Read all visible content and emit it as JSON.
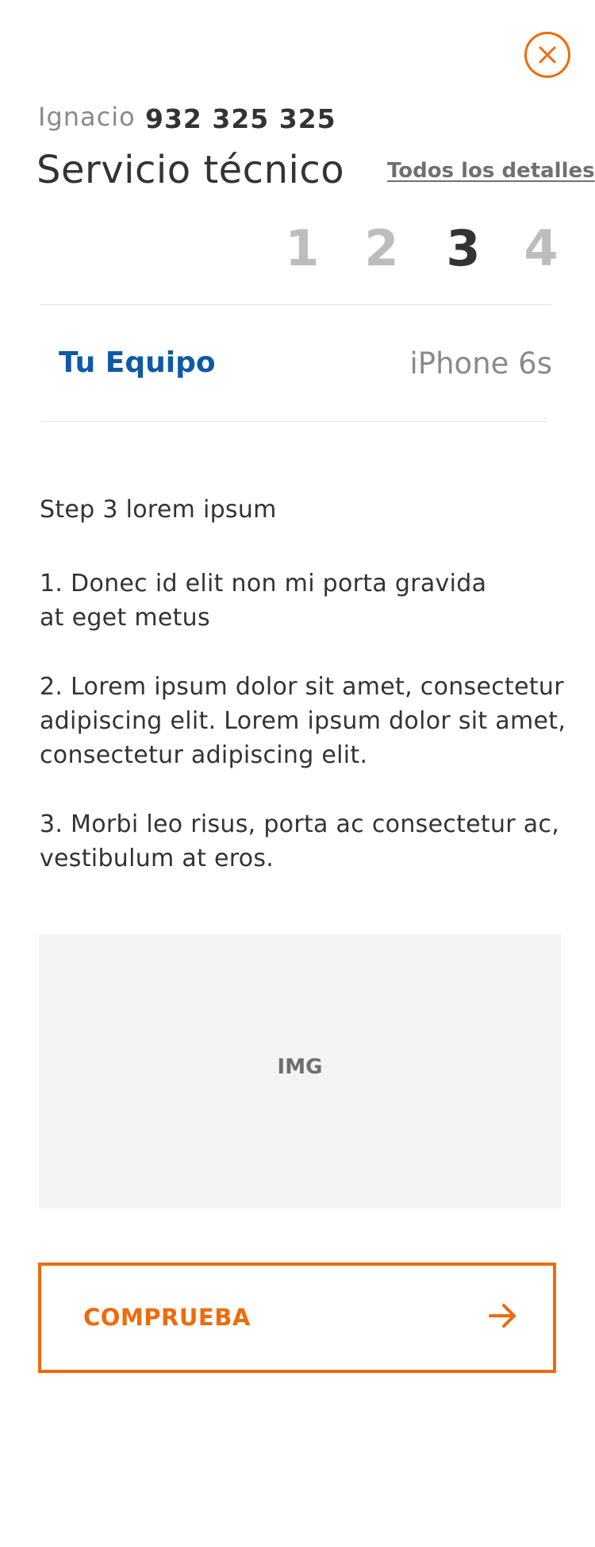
{
  "header": {
    "close_icon": "close-icon",
    "user_name": "Ignacio",
    "phone": "932 325 325",
    "title": "Servicio técnico",
    "details_link": "Todos los detalles"
  },
  "steps": {
    "items": [
      "1",
      "2",
      "3",
      "4"
    ],
    "active": "3"
  },
  "device": {
    "label": "Tu Equipo",
    "value": "iPhone 6s"
  },
  "content": {
    "intro": "Step 3 lorem ipsum",
    "items": [
      "1. Donec id elit non mi porta gravida\n at eget metus",
      "2. Lorem ipsum dolor sit amet, consectetur adipiscing elit. Lorem ipsum dolor sit amet, consectetur adipiscing elit.",
      "3. Morbi leo risus, porta ac consectetur ac, vestibulum at eros."
    ]
  },
  "image": {
    "placeholder_label": "IMG"
  },
  "cta": {
    "label": "COMPRUEBA",
    "icon": "arrow-right-icon"
  },
  "colors": {
    "accent": "#f06a0a",
    "link_blue": "#0d5aa6",
    "text_dark": "#333333",
    "text_muted": "#8a8a8a",
    "step_inactive": "#bdbdbd",
    "placeholder_bg": "#f3f3f3"
  }
}
